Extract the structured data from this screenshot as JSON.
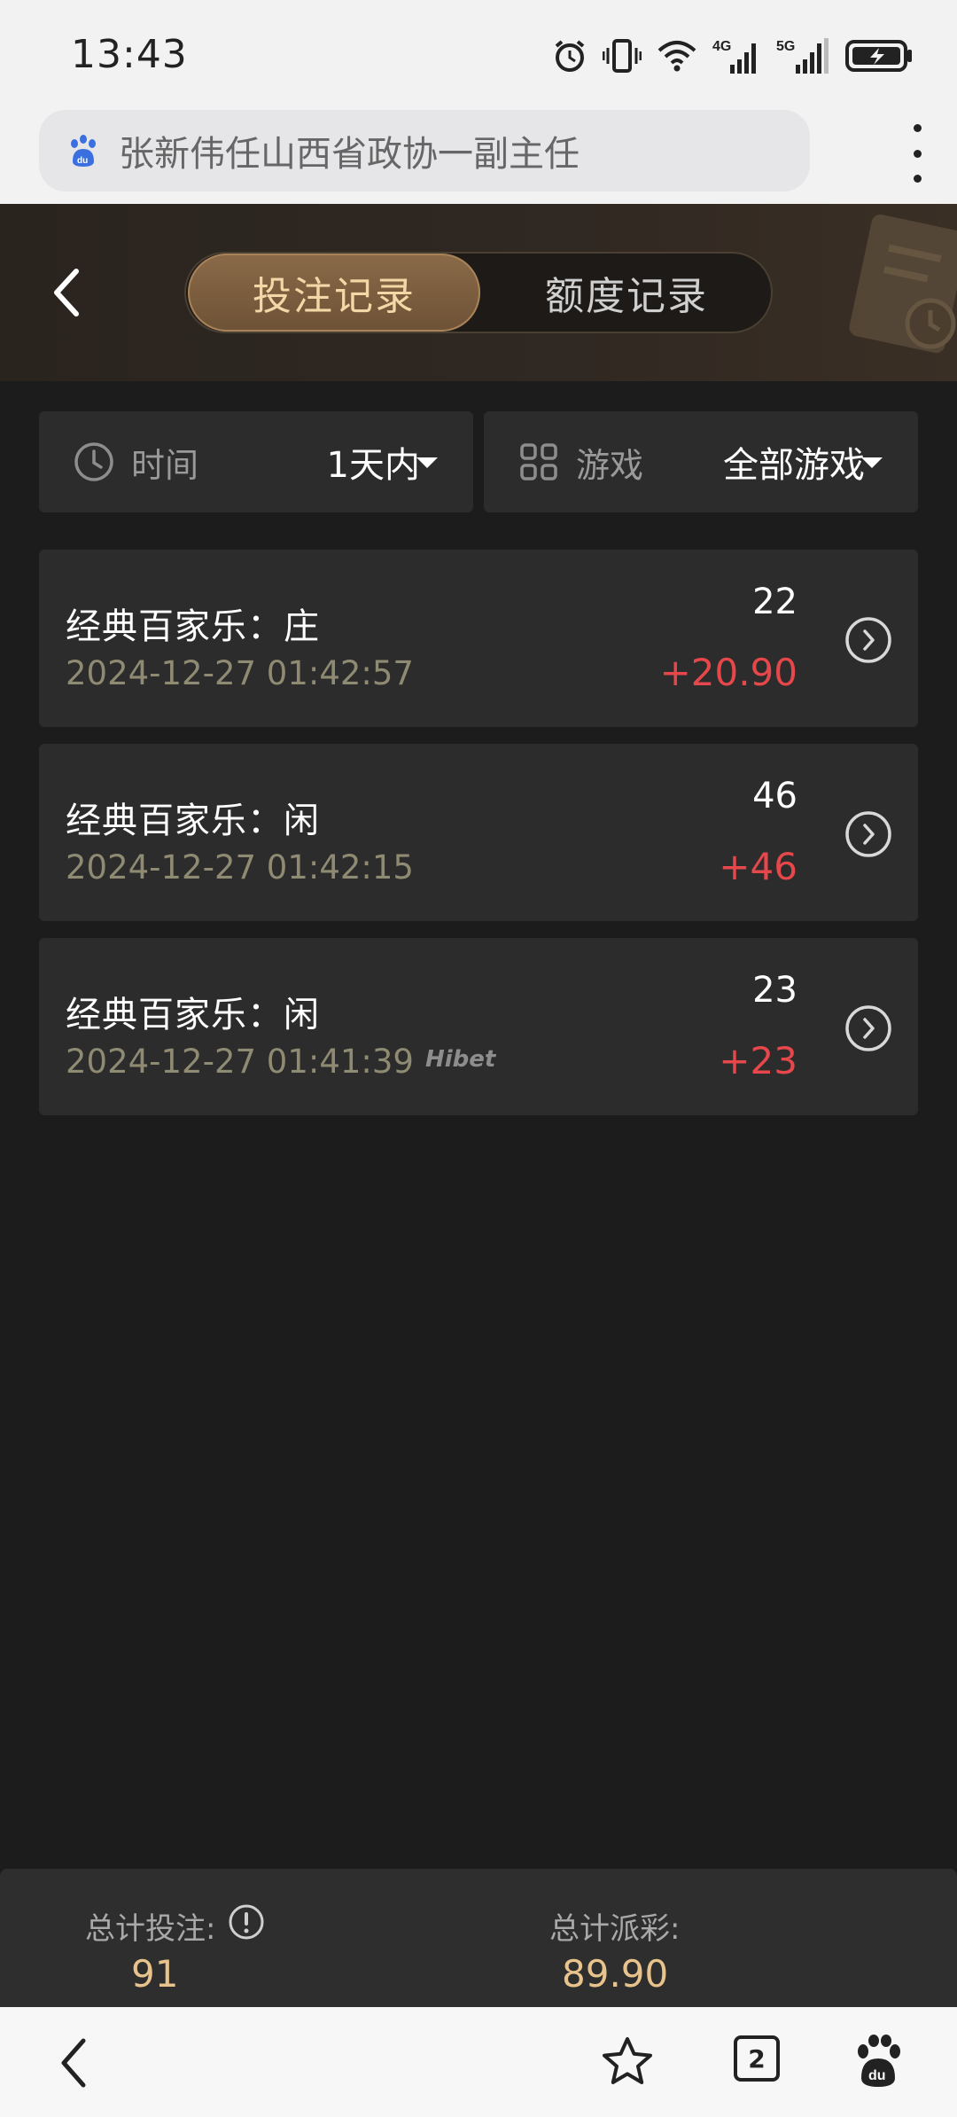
{
  "status_bar": {
    "time": "13:43",
    "network_4g": "4G",
    "network_5g": "5G"
  },
  "browser": {
    "search_text": "张新伟任山西省政协一副主任",
    "tab_count": "2"
  },
  "header": {
    "tabs": [
      {
        "label": "投注记录",
        "active": true
      },
      {
        "label": "额度记录",
        "active": false
      }
    ]
  },
  "filters": {
    "time": {
      "label": "时间",
      "value": "1天内"
    },
    "game": {
      "label": "游戏",
      "value": "全部游戏"
    }
  },
  "records": [
    {
      "title": "经典百家乐：庄",
      "time": "2024-12-27 01:42:57",
      "bet": "22",
      "payout": "+20.90"
    },
    {
      "title": "经典百家乐：闲",
      "time": "2024-12-27 01:42:15",
      "bet": "46",
      "payout": "+46"
    },
    {
      "title": "经典百家乐：闲",
      "time": "2024-12-27 01:41:39",
      "bet": "23",
      "payout": "+23"
    }
  ],
  "watermark": "Hibet",
  "summary": {
    "total_bet_label": "总计投注:",
    "total_bet_value": "91",
    "total_payout_label": "总计派彩:",
    "total_payout_value": "89.90"
  },
  "colors": {
    "accent_gold": "#e8c48c",
    "payout_red": "#e5474b",
    "card_bg": "#2c2c2c",
    "page_bg": "#1c1c1c"
  }
}
